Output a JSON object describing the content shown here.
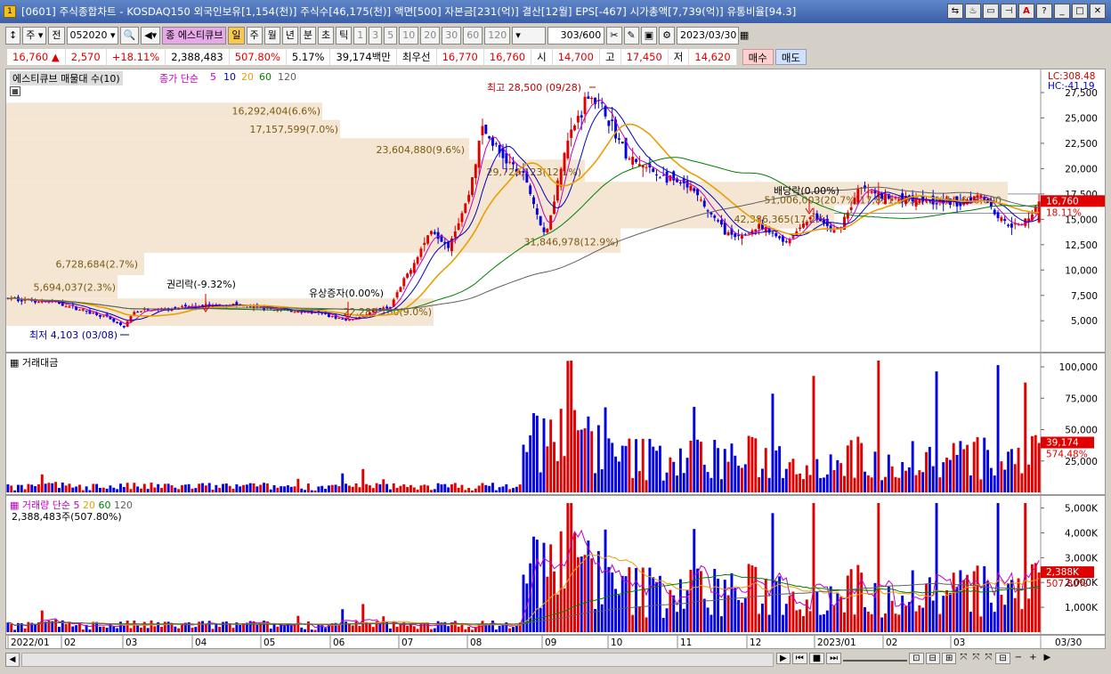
{
  "window": {
    "title": "[0601] 주식종합차트 - KOSDAQ150 외국인보유[1,154(천)] 주식수[46,175(천)] 액면[500] 자본금[231(억)] 결산[12월] EPS[-467] 시가총액[7,739(억)] 유통비율[94.3]",
    "icon_label": "1",
    "buttons": [
      "⇆",
      "♨",
      "▭",
      "⊣",
      "A",
      "?",
      "_",
      "□",
      "✕"
    ]
  },
  "toolbar": {
    "period_select": "주",
    "prev_label": "전",
    "code": "052020",
    "item_name": "에스티큐브",
    "periods": [
      "일",
      "주",
      "월",
      "년",
      "분",
      "초",
      "틱"
    ],
    "active_period": "일",
    "intervals": [
      "1",
      "3",
      "5",
      "10",
      "20",
      "30",
      "60",
      "120"
    ],
    "count": "303",
    "count_total": "/600",
    "date": "2023/03/30"
  },
  "quote": {
    "price": "16,760",
    "arrow": "▲",
    "change": "2,570",
    "change_pct": "+18.11%",
    "volume": "2,388,483",
    "vol_ratio": "507.80%",
    "turnover": "5.17%",
    "amount": "39,174백만",
    "best_ask_label": "최우선",
    "best_ask": "16,770",
    "best_bid": "16,760",
    "open_label": "시",
    "open": "14,700",
    "high_label": "고",
    "high": "17,450",
    "low_label": "저",
    "low": "14,620",
    "buy_label": "매수",
    "sell_label": "매도"
  },
  "price_panel": {
    "title": "에스티큐브 매물대 수(10)",
    "ma_label": "종가 단순",
    "ma_periods": [
      "5",
      "10",
      "20",
      "60",
      "120"
    ],
    "lc": "LC:308.48",
    "hc": "HC:-41.19",
    "high_annot": "최고 28,500 (09/28)",
    "low_annot": "최저 4,103 (03/08)",
    "event1": "권리락(-9.32%)",
    "event2": "유상증자(0.00%)",
    "event3": "배당락(0.00%)",
    "last_price": "16,760",
    "last_pct": "18.11%",
    "y_ticks": [
      "27,500",
      "25,000",
      "22,500",
      "20,000",
      "17,500",
      "15,000",
      "12,500",
      "10,000",
      "7,500",
      "5,000"
    ],
    "volume_profile": [
      {
        "label": "16,292,404(6.6%)"
      },
      {
        "label": "17,157,599(7.0%)"
      },
      {
        "label": "23,604,880(9.6%)"
      },
      {
        "label": "29,729,123(12.1%)"
      },
      {
        "label": "51,006,003(20.7%)"
      },
      {
        "label": "17,851,863(7.2%)"
      },
      {
        "label": "14,626,000"
      },
      {
        "label": "42,386,365(17.2%)"
      },
      {
        "label": "31,846,978(12.9%)"
      },
      {
        "label": "6,728,684(2.7%)"
      },
      {
        "label": "5,694,037(2.3%)"
      },
      {
        "label": "22,289,100(9.0%)"
      }
    ]
  },
  "amount_panel": {
    "title": "거래대금",
    "y_ticks": [
      "100,000",
      "75,000",
      "50,000",
      "25,000"
    ],
    "last_value": "39,174",
    "last_pct": "574.48%"
  },
  "volume_panel": {
    "title": "거래량 단순",
    "ma_periods": [
      "5",
      "20",
      "60",
      "120"
    ],
    "summary": "2,388,483주(507.80%)",
    "y_ticks": [
      "5,000K",
      "4,000K",
      "3,000K",
      "2,000K",
      "1,000K"
    ],
    "last_value": "2,388K",
    "last_pct": "507.80%"
  },
  "x_axis": {
    "labels": [
      "2022/01",
      "02",
      "03",
      "04",
      "05",
      "06",
      "07",
      "08",
      "09",
      "10",
      "11",
      "12",
      "2023/01",
      "02",
      "03"
    ],
    "cursor_date": "03/30"
  },
  "colors": {
    "up": "#e00000",
    "down": "#0000e0",
    "ma5": "#c000c0",
    "ma10": "#0000c0",
    "ma20": "#e8a000",
    "ma60": "#008000",
    "ma120": "#606060",
    "profile": "#f5e6d3"
  }
}
